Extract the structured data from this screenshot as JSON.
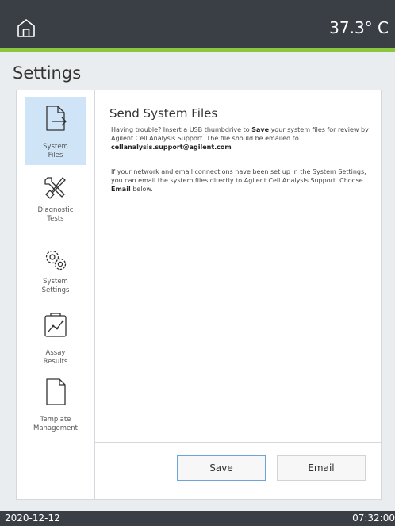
{
  "header": {
    "temperature": "37.3° C",
    "home_icon": "home-icon"
  },
  "page": {
    "title": "Settings"
  },
  "sidebar": {
    "items": [
      {
        "label": "System\nFiles",
        "icon": "system-files-icon",
        "active": true
      },
      {
        "label": "Diagnostic\nTests",
        "icon": "tools-icon",
        "active": false
      },
      {
        "label": "System\nSettings",
        "icon": "gears-icon",
        "active": false
      },
      {
        "label": "Assay\nResults",
        "icon": "results-chart-icon",
        "active": false
      },
      {
        "label": "Template\nManagement",
        "icon": "document-icon",
        "active": false
      }
    ]
  },
  "content": {
    "heading": "Send System Files",
    "p1_a": "Having trouble? Insert a USB thumbdrive to ",
    "p1_b": "Save",
    "p1_c": " your system files for review by Agilent Cell Analysis Support. The file should be emailed to ",
    "p1_d": "cellanalysis.support@agilent.com",
    "p2_a": "If your network and email connections have been set up in the System Settings, you can email the system files directly to Agilent Cell Analysis Support. Choose ",
    "p2_b": "Email",
    "p2_c": " below."
  },
  "buttons": {
    "save": "Save",
    "email": "Email"
  },
  "status": {
    "date": "2020-12-12",
    "time": "07:32:00"
  },
  "colors": {
    "topbar": "#3a3f45",
    "accent_green": "#8cc63f",
    "active_nav": "#cfe4f6"
  }
}
